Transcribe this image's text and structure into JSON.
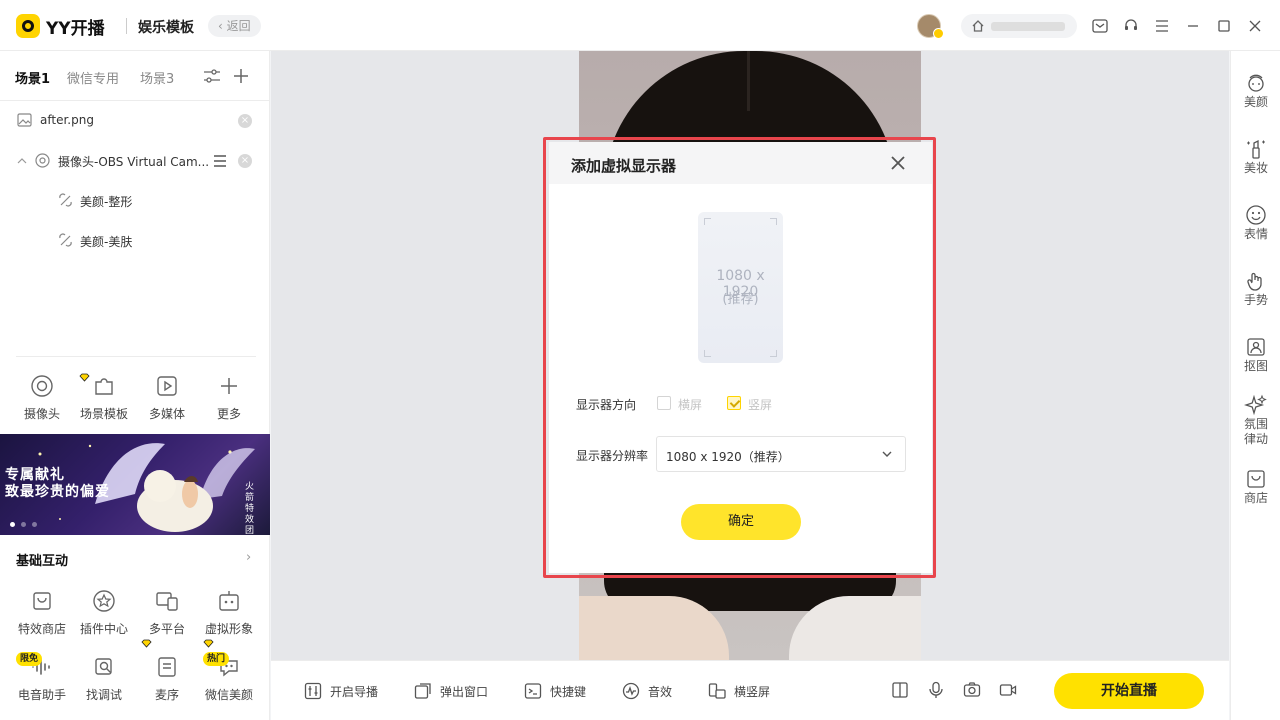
{
  "app": {
    "logo_text": "YY开播",
    "title": "娱乐模板",
    "back_label": "返回"
  },
  "scene_tabs": [
    "场景1",
    "微信专用",
    "场景3"
  ],
  "sources": [
    {
      "label": "after.png",
      "icon": "image-icon"
    },
    {
      "label": "摄像头-OBS Virtual Cam...",
      "icon": "camera-icon"
    },
    {
      "label": "美颜-整形",
      "icon": "beauty-filter-icon"
    },
    {
      "label": "美颜-美肤",
      "icon": "beauty-filter-icon"
    }
  ],
  "add_tools": [
    {
      "label": "摄像头",
      "icon": "camera-icon"
    },
    {
      "label": "场景模板",
      "icon": "puzzle-icon",
      "vip": true
    },
    {
      "label": "多媒体",
      "icon": "play-icon"
    },
    {
      "label": "更多",
      "icon": "plus-icon"
    }
  ],
  "banner": {
    "line1": "专属献礼",
    "line2": "致最珍贵的偏爱",
    "vertical": "火箭特效团"
  },
  "interaction": {
    "title": "基础互动",
    "arrow": "›",
    "items": [
      {
        "label": "特效商店",
        "icon": "shop-icon"
      },
      {
        "label": "插件中心",
        "icon": "star-icon"
      },
      {
        "label": "多平台",
        "icon": "multi-screen-icon",
        "vip": true
      },
      {
        "label": "虚拟形象",
        "icon": "avatar-robot-icon",
        "vip": true
      },
      {
        "label": "电音助手",
        "icon": "audio-wave-icon",
        "tag": "限免"
      },
      {
        "label": "找调试",
        "icon": "debug-search-icon"
      },
      {
        "label": "麦序",
        "icon": "list-icon"
      },
      {
        "label": "微信美颜",
        "icon": "wechat-beauty-icon",
        "tag": "热门"
      }
    ]
  },
  "dialog": {
    "title": "添加虚拟显示器",
    "preview_resolution": "1080 x 1920",
    "preview_note": "(推荐)",
    "orientation_label": "显示器方向",
    "landscape_label": "横屏",
    "portrait_label": "竖屏",
    "landscape_checked": false,
    "portrait_checked": true,
    "resolution_label": "显示器分辨率",
    "resolution_value": "1080 x 1920（推荐）",
    "confirm_label": "确定"
  },
  "bottom_bar": {
    "items": [
      {
        "label": "开启导播",
        "icon": "director-icon"
      },
      {
        "label": "弹出窗口",
        "icon": "popout-icon"
      },
      {
        "label": "快捷键",
        "icon": "keyboard-icon"
      },
      {
        "label": "音效",
        "icon": "sound-effect-icon"
      },
      {
        "label": "横竖屏",
        "icon": "rotate-screen-icon"
      }
    ],
    "go_live_label": "开始直播"
  },
  "right_bar": [
    {
      "label": "美颜",
      "icon": "beauty-icon"
    },
    {
      "label": "美妆",
      "icon": "makeup-icon"
    },
    {
      "label": "表情",
      "icon": "smiley-icon"
    },
    {
      "label": "手势",
      "icon": "gesture-icon"
    },
    {
      "label": "抠图",
      "icon": "cutout-icon"
    },
    {
      "label": "氛围律动",
      "icon": "sparkle-icon"
    },
    {
      "label": "商店",
      "icon": "store-icon"
    }
  ],
  "colors": {
    "accent": "#ffe100",
    "highlight_border": "#e8454c"
  }
}
